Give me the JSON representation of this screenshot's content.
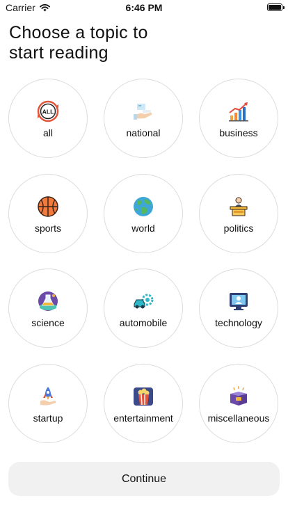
{
  "status_bar": {
    "carrier": "Carrier",
    "time": "6:46 PM"
  },
  "title": "Choose a topic to\nstart reading",
  "topics": [
    {
      "label": "all",
      "icon": "all-icon"
    },
    {
      "label": "national",
      "icon": "national-icon"
    },
    {
      "label": "business",
      "icon": "business-chart-icon"
    },
    {
      "label": "sports",
      "icon": "basketball-icon"
    },
    {
      "label": "world",
      "icon": "globe-icon"
    },
    {
      "label": "politics",
      "icon": "podium-icon"
    },
    {
      "label": "science",
      "icon": "science-flask-icon"
    },
    {
      "label": "automobile",
      "icon": "car-gear-icon"
    },
    {
      "label": "technology",
      "icon": "technology-screen-icon"
    },
    {
      "label": "startup",
      "icon": "rocket-icon"
    },
    {
      "label": "entertainment",
      "icon": "popcorn-icon"
    },
    {
      "label": "miscellaneous",
      "icon": "box-icon"
    }
  ],
  "continue_label": "Continue"
}
